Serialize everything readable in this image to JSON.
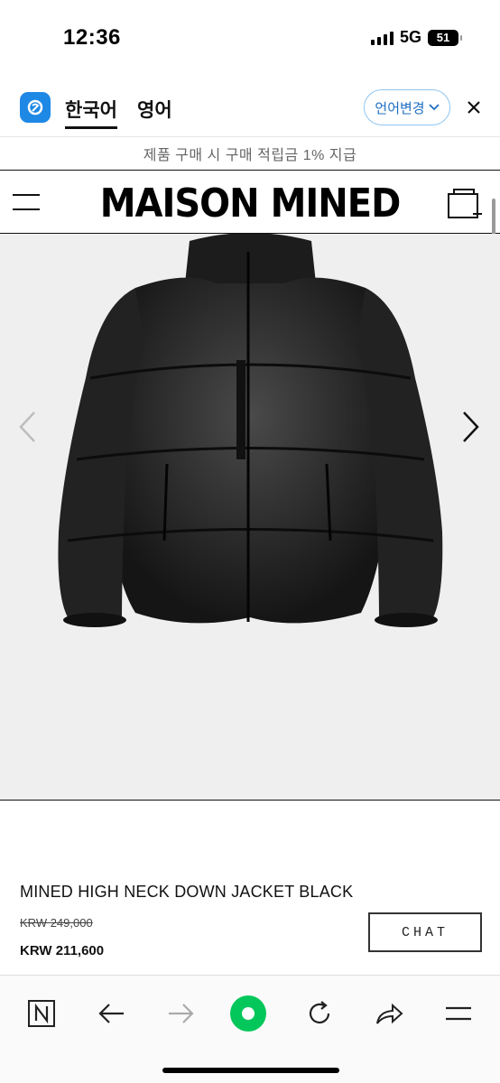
{
  "status_bar": {
    "time": "12:36",
    "network": "5G",
    "battery": "51"
  },
  "translate_bar": {
    "tab_korean": "한국어",
    "tab_english": "영어",
    "change_language": "언어변경",
    "brand_color": "#1e88e5"
  },
  "promo": {
    "text": "제품 구매 시 구매 적립금 1% 지급"
  },
  "header": {
    "logo": "MAISON MINED",
    "menu_icon": "hamburger-icon",
    "cart_icon": "cart-icon"
  },
  "gallery": {
    "prev_icon": "chevron-left-icon",
    "next_icon": "chevron-right-icon",
    "image_alt": "black high neck down jacket"
  },
  "product": {
    "name": "MINED HIGH NECK DOWN JACKET BLACK",
    "original_price": "KRW 249,000",
    "sale_price": "KRW 211,600",
    "chat_label": "CHAT"
  },
  "toolbar": {
    "items": [
      "naver-home-icon",
      "back-icon",
      "forward-icon",
      "green-dot-icon",
      "refresh-icon",
      "share-icon",
      "menu-icon"
    ],
    "accent": "#03c75a"
  }
}
